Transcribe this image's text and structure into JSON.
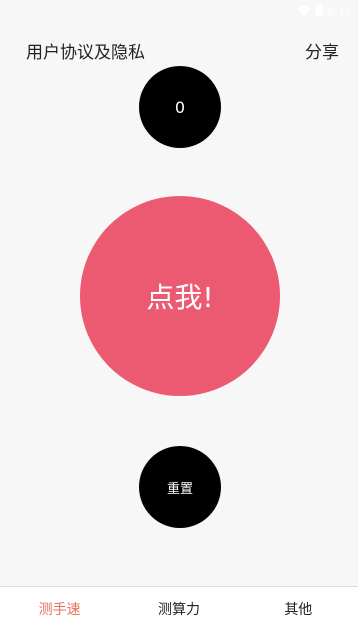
{
  "status_bar": {
    "time": "8:18",
    "icons": [
      "wifi-icon",
      "signal-icon",
      "battery-icon"
    ]
  },
  "header": {
    "left_link": "用户协议及隐私",
    "right_link": "分享"
  },
  "counter": {
    "value": "0"
  },
  "tap_button": {
    "label": "点我!",
    "color": "#ec5a72"
  },
  "reset_button": {
    "label": "重置"
  },
  "tabs": [
    {
      "label": "测手速",
      "active": true
    },
    {
      "label": "测算力",
      "active": false
    },
    {
      "label": "其他",
      "active": false
    }
  ],
  "colors": {
    "active_tab": "#e8705a",
    "background": "#f7f7f7"
  }
}
